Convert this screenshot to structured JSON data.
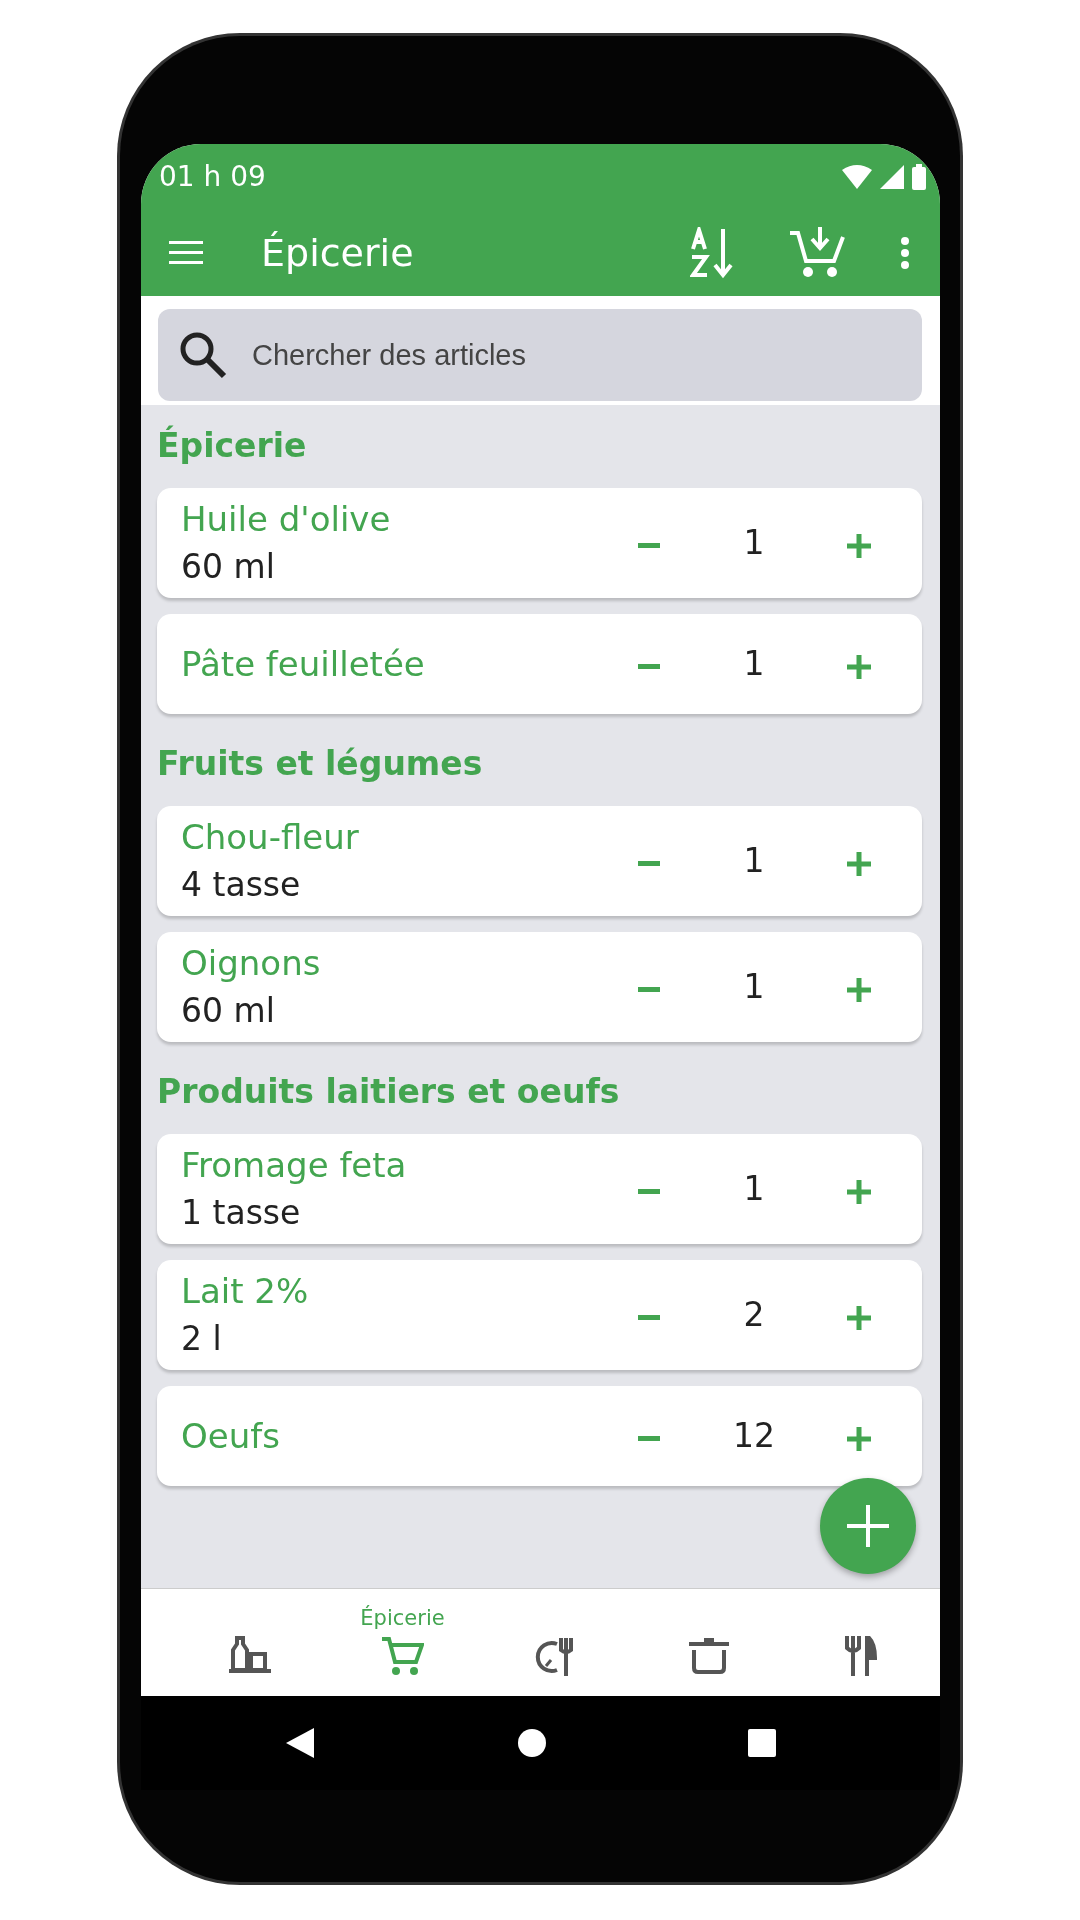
{
  "status_bar": {
    "time": "01 h 09"
  },
  "app_bar": {
    "title": "Épicerie"
  },
  "search": {
    "placeholder": "Chercher des articles"
  },
  "sections": [
    {
      "title": "Épicerie",
      "items": [
        {
          "name": "Huile d'olive",
          "amount": "60 ml",
          "quantity": "1"
        },
        {
          "name": "Pâte feuilletée",
          "quantity": "1"
        }
      ]
    },
    {
      "title": "Fruits et légumes",
      "items": [
        {
          "name": "Chou-fleur",
          "amount": "4 tasse",
          "quantity": "1"
        },
        {
          "name": "Oignons",
          "amount": "60 ml",
          "quantity": "1"
        }
      ]
    },
    {
      "title": "Produits laitiers et oeufs",
      "items": [
        {
          "name": "Fromage feta",
          "amount": "1 tasse",
          "quantity": "1"
        },
        {
          "name": "Lait 2%",
          "amount": "2 l",
          "quantity": "2"
        },
        {
          "name": "Oeufs",
          "quantity": "12"
        }
      ]
    }
  ],
  "bottom_nav": [
    {
      "selected": false
    },
    {
      "label": "Épicerie",
      "selected": true
    },
    {
      "selected": false
    },
    {
      "selected": false
    },
    {
      "selected": false
    }
  ]
}
